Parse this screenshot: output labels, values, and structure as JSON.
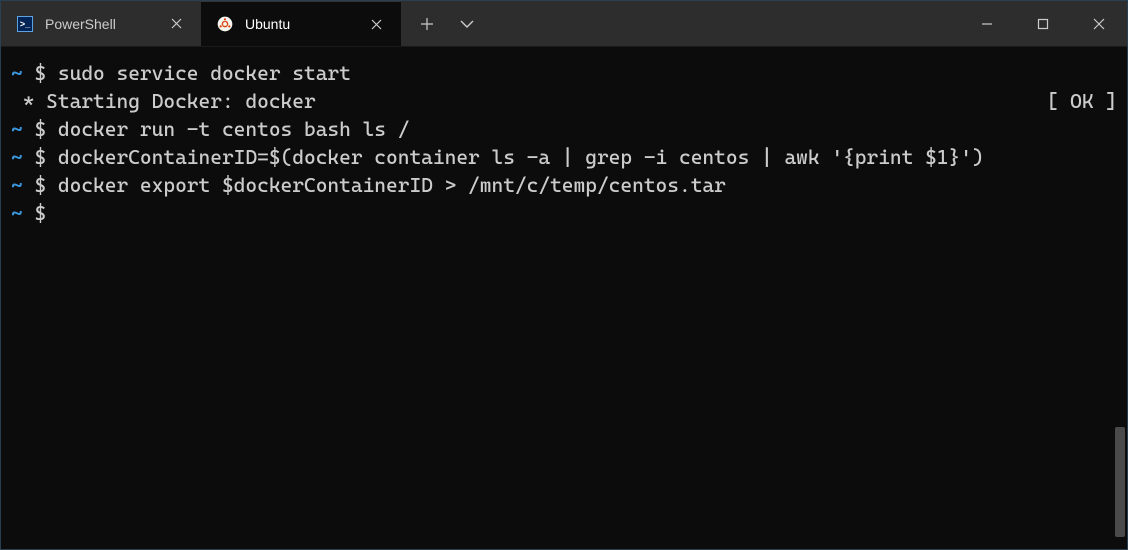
{
  "tabs": [
    {
      "label": "PowerShell",
      "icon_name": "powershell-icon",
      "active": false
    },
    {
      "label": "Ubuntu",
      "icon_name": "ubuntu-icon",
      "active": true
    }
  ],
  "terminal": {
    "lines": [
      {
        "prompt": "~ $ ",
        "command": "sudo service docker start"
      },
      {
        "output": " * Starting Docker: docker",
        "status": "[ OK ]"
      },
      {
        "prompt": "~ $ ",
        "command": "docker run -t centos bash ls /"
      },
      {
        "prompt": "~ $ ",
        "command": "dockerContainerID=$(docker container ls -a | grep -i centos | awk '{print $1}')"
      },
      {
        "prompt": "~ $ ",
        "command": "docker export $dockerContainerID > /mnt/c/temp/centos.tar"
      },
      {
        "prompt": "~ $ ",
        "command": ""
      }
    ]
  },
  "colors": {
    "prompt_tilde": "#3a96dd",
    "text": "#cccccc",
    "background": "#0c0c0c",
    "titlebar": "#2d2d2d"
  }
}
